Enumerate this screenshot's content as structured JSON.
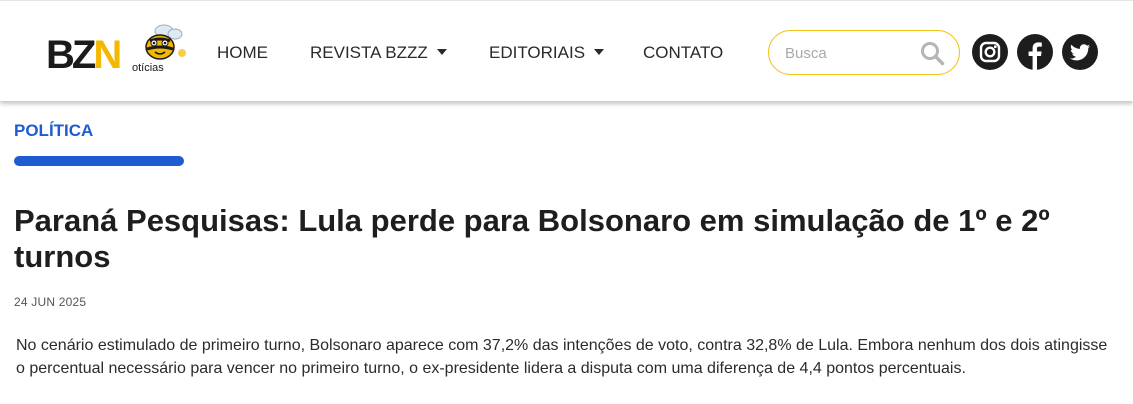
{
  "brand": {
    "logo_letters": "BZN",
    "logo_sub": "otícias",
    "accent_color": "#f5b800"
  },
  "nav": {
    "items": [
      {
        "label": "HOME",
        "has_dropdown": false
      },
      {
        "label": "REVISTA BZZZ",
        "has_dropdown": true
      },
      {
        "label": "EDITORIAIS",
        "has_dropdown": true
      },
      {
        "label": "CONTATO",
        "has_dropdown": false
      }
    ]
  },
  "search": {
    "placeholder": "Busca",
    "value": "",
    "icon": "search-icon",
    "border_color": "#f0c419"
  },
  "social": [
    {
      "name": "instagram-icon"
    },
    {
      "name": "facebook-icon"
    },
    {
      "name": "twitter-icon"
    }
  ],
  "article": {
    "category": "POLÍTICA",
    "category_color": "#1f5bd1",
    "headline": "Paraná Pesquisas: Lula perde para Bolsonaro em simulação de 1º e 2º turnos",
    "date": "24 JUN 2025",
    "lead": "No cenário estimulado de primeiro turno, Bolsonaro aparece com 37,2% das intenções de voto, contra 32,8% de Lula. Embora nenhum dos dois atingisse o percentual necessário para vencer no primeiro turno, o ex-presidente lidera a disputa com uma diferença de 4,4 pontos percentuais."
  }
}
